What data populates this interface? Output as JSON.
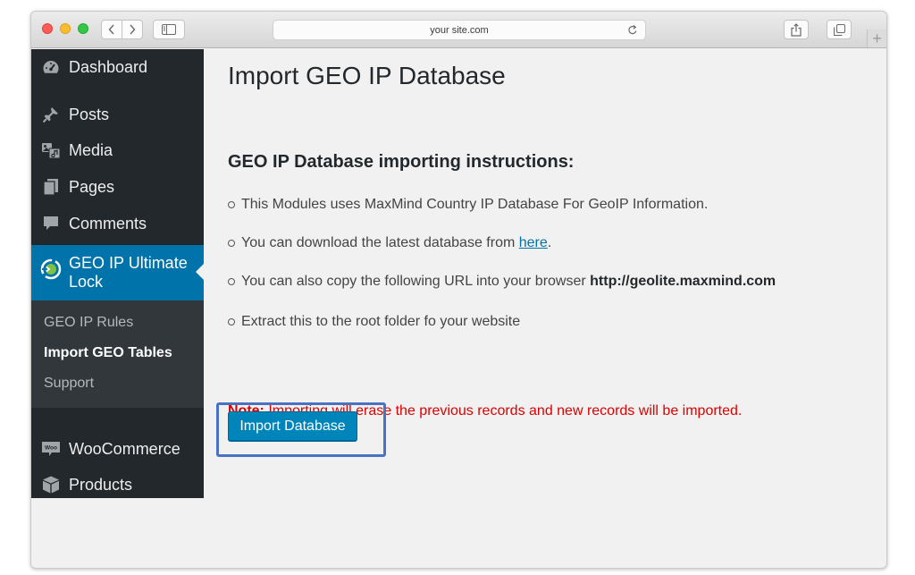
{
  "browser": {
    "url": "your site.com"
  },
  "sidebar": {
    "items": [
      {
        "label": "Dashboard",
        "icon": "dashboard-icon"
      },
      {
        "label": "Posts",
        "icon": "pin-icon"
      },
      {
        "label": "Media",
        "icon": "media-icon"
      },
      {
        "label": "Pages",
        "icon": "pages-icon"
      },
      {
        "label": "Comments",
        "icon": "comment-icon"
      },
      {
        "label": "GEO IP Ultimate Lock",
        "icon": "geo-ip-icon"
      },
      {
        "label": "WooCommerce",
        "icon": "woocommerce-icon"
      },
      {
        "label": "Products",
        "icon": "box-icon"
      }
    ],
    "submenu": [
      {
        "label": "GEO IP Rules"
      },
      {
        "label": "Import GEO Tables"
      },
      {
        "label": "Support"
      }
    ],
    "woo_badge": "Woo"
  },
  "main": {
    "title": "Import GEO IP Database",
    "section_title": "GEO IP Database importing instructions:",
    "instructions": {
      "line1": "This Modules uses MaxMind Country IP Database For GeoIP Information.",
      "line2_prefix": "You can download the latest database from ",
      "line2_link": "here",
      "line2_suffix": ".",
      "line3_prefix": "You can also copy the following URL into your browser ",
      "line3_url": "http://geolite.maxmind.com",
      "line4": "Extract this to the root folder fo your website"
    },
    "note_label": "Note:",
    "note_text": " Importing will erase the previous records and new records will be imported.",
    "import_button": "Import Database"
  },
  "colors": {
    "sidebar_bg": "#23282d",
    "active_bg": "#0073aa",
    "button_bg": "#0085ba",
    "note_red": "#dd0000",
    "highlight_border": "#4a72c2"
  }
}
